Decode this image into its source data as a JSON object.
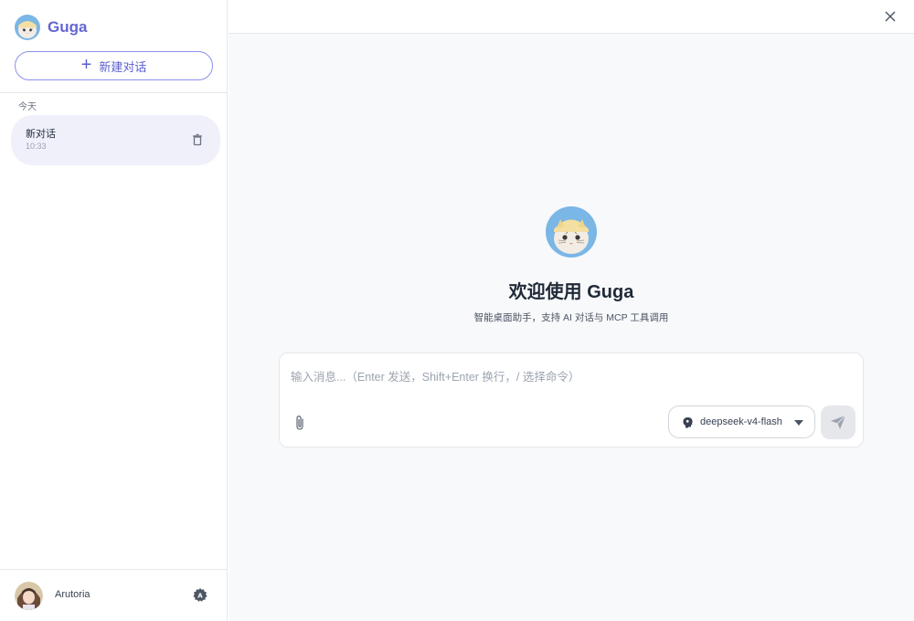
{
  "sidebar": {
    "brand": "Guga",
    "new_chat_label": "新建对话",
    "group_today": "今天",
    "chats": [
      {
        "title": "新对话",
        "time": "10:33"
      }
    ],
    "user_name": "Arutoria"
  },
  "main": {
    "welcome_title": "欢迎使用 Guga",
    "welcome_subtitle": "智能桌面助手，支持 AI 对话与 MCP 工具调用",
    "input_placeholder": "输入消息...（Enter 发送，Shift+Enter 换行，/ 选择命令）",
    "model_name": "deepseek-v4-flash"
  },
  "colors": {
    "accent": "#6366d1",
    "chat_item_bg": "#f0f0fb",
    "main_bg": "#f8f9fb"
  },
  "icons": [
    "plus-icon",
    "trash-icon",
    "settings-icon",
    "close-icon",
    "attach-icon",
    "brain-icon",
    "chevron-down-icon",
    "send-icon"
  ]
}
